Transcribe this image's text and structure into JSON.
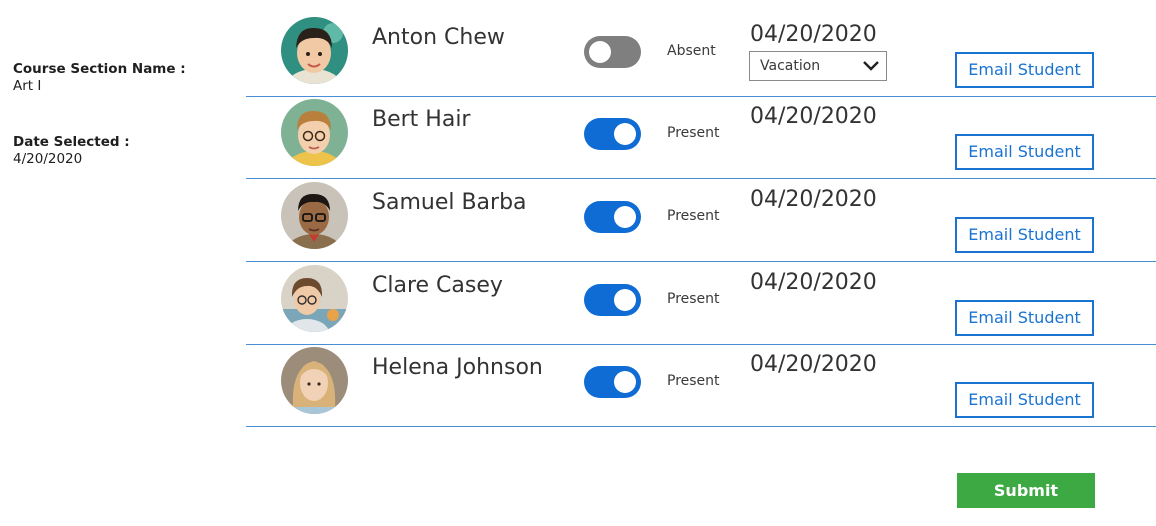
{
  "sidebar": {
    "course_section_label": "Course Section Name :",
    "course_section_value": "Art I",
    "date_selected_label": "Date Selected :",
    "date_selected_value": "4/20/2020"
  },
  "students": [
    {
      "name": "Anton Chew",
      "present": false,
      "status": "Absent",
      "date": "04/20/2020",
      "reason": "Vacation",
      "email_label": "Email Student"
    },
    {
      "name": "Bert Hair",
      "present": true,
      "status": "Present",
      "date": "04/20/2020",
      "email_label": "Email Student"
    },
    {
      "name": "Samuel Barba",
      "present": true,
      "status": "Present",
      "date": "04/20/2020",
      "email_label": "Email Student"
    },
    {
      "name": "Clare Casey",
      "present": true,
      "status": "Present",
      "date": "04/20/2020",
      "email_label": "Email Student"
    },
    {
      "name": "Helena Johnson",
      "present": true,
      "status": "Present",
      "date": "04/20/2020",
      "email_label": "Email Student"
    }
  ],
  "submit_label": "Submit",
  "colors": {
    "toggle_on": "#0f6cd4",
    "toggle_off": "#7f7f7f",
    "accent_blue": "#1a73d1",
    "divider": "#4a8fd6",
    "submit_green": "#3da943"
  }
}
